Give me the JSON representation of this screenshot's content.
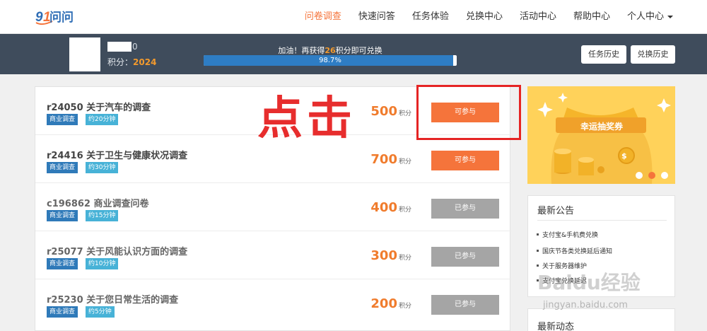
{
  "brand": {
    "name": "91问问",
    "colors": {
      "accent": "#f5743b",
      "nav_bar": "#3f4c5c",
      "progress": "#2e7dc4",
      "tag_business": "#2f7ab9",
      "tag_time": "#47b2d7",
      "disabled": "#a5a5a5",
      "annotation": "#e52424"
    }
  },
  "nav": {
    "items": [
      {
        "label": "问卷调查",
        "active": true
      },
      {
        "label": "快速问答"
      },
      {
        "label": "任务体验"
      },
      {
        "label": "兑换中心"
      },
      {
        "label": "活动中心"
      },
      {
        "label": "帮助中心"
      }
    ],
    "user_menu": "个人中心"
  },
  "status": {
    "username_suffix": "0",
    "points_label": "积分：",
    "points_value": "2024",
    "progress_prefix": "加油！再获得",
    "progress_value": "26",
    "progress_suffix": "积分即可兑换",
    "progress_percent": "98.7%",
    "progress_fraction": 0.987,
    "task_history": "任务历史",
    "exchange_history": "兑换历史"
  },
  "surveys": [
    {
      "title": "r24050 关于汽车的调查",
      "tag1": "商业调查",
      "tag2": "约20分钟",
      "points": "500",
      "unit": "积分",
      "button": "可参与",
      "available": true
    },
    {
      "title": "r24416 关于卫生与健康状况调查",
      "tag1": "商业调查",
      "tag2": "约30分钟",
      "points": "700",
      "unit": "积分",
      "button": "可参与",
      "available": true
    },
    {
      "title": "c196862 商业调查问卷",
      "tag1": "商业调查",
      "tag2": "约15分钟",
      "points": "400",
      "unit": "积分",
      "button": "已参与",
      "available": false
    },
    {
      "title": "r25077 关于风能认识方面的调查",
      "tag1": "商业调查",
      "tag2": "约10分钟",
      "points": "300",
      "unit": "积分",
      "button": "已参与",
      "available": false
    },
    {
      "title": "r25230 关于您日常生活的调查",
      "tag1": "商业调查",
      "tag2": "约5分钟",
      "points": "200",
      "unit": "积分",
      "button": "已参与",
      "available": false
    }
  ],
  "annotation": {
    "text": "点击"
  },
  "sidebar": {
    "banner_text": "幸运抽奖券",
    "notices_title": "最新公告",
    "notices": [
      "支付宝&手机费兑换",
      "国庆节各类兑换延后通知",
      "关于服务器维护",
      "支付宝兑换延迟"
    ],
    "activity_title": "最新动态"
  },
  "watermark": {
    "line1": "Baidu经验",
    "line2": "jingyan.baidu.com"
  }
}
